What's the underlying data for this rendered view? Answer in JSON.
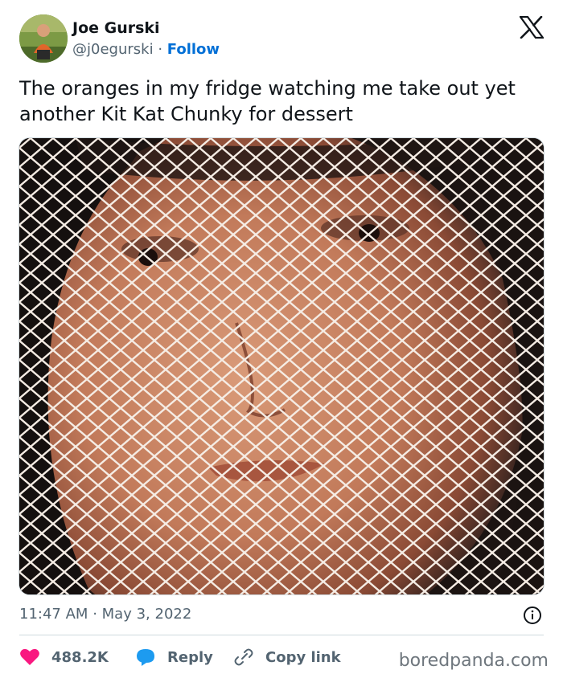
{
  "author": {
    "name": "Joe Gurski",
    "handle": "@j0egurski",
    "separator": "·",
    "follow_label": "Follow",
    "avatar_icon": "avatar-photo"
  },
  "tweet": {
    "text": "The oranges in my fridge watching me take out yet another Kit Kat Chunky for dessert",
    "time": "11:47 AM",
    "date_separator": "·",
    "date": "May 3, 2022"
  },
  "actions": {
    "likes": "488.2K",
    "reply_label": "Reply",
    "copy_link_label": "Copy link"
  },
  "icons": {
    "platform": "x-logo-icon",
    "info": "info-icon",
    "like": "heart-icon",
    "reply": "speech-bubble-icon",
    "copy": "link-icon"
  },
  "watermark": "boredpanda.com",
  "colors": {
    "follow": "#006fd6",
    "like": "#f91880",
    "reply": "#1d9bf0",
    "secondary_text": "#536471"
  }
}
